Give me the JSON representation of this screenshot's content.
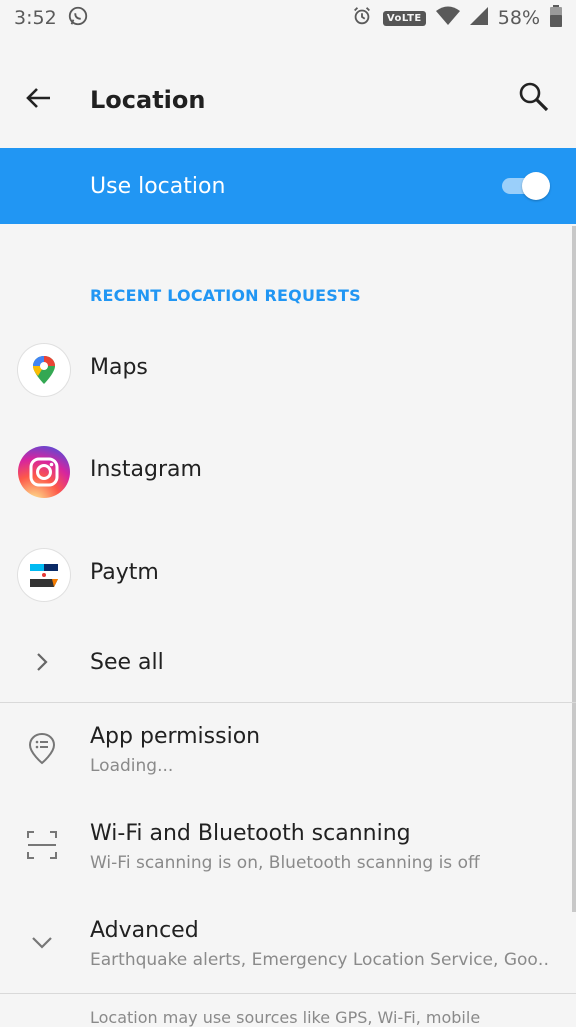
{
  "status_bar": {
    "time": "3:52",
    "volte": "VoLTE",
    "battery": "58%"
  },
  "toolbar": {
    "title": "Location"
  },
  "master_switch": {
    "label": "Use location",
    "enabled": true,
    "accent": "#2196f3"
  },
  "recent": {
    "header": "RECENT LOCATION REQUESTS",
    "apps": [
      {
        "label": "Maps",
        "icon": "maps-icon"
      },
      {
        "label": "Instagram",
        "icon": "instagram-icon"
      },
      {
        "label": "Paytm",
        "icon": "paytm-icon"
      }
    ],
    "see_all": "See all"
  },
  "prefs": [
    {
      "title": "App permission",
      "summary": "Loading...",
      "icon": "location-list-icon"
    },
    {
      "title": "Wi-Fi and Bluetooth scanning",
      "summary": "Wi-Fi scanning is on, Bluetooth scanning is off",
      "icon": "scan-icon"
    },
    {
      "title": "Advanced",
      "summary": "Earthquake alerts, Emergency Location Service, Goo‥",
      "icon": "chevron-down-icon"
    }
  ],
  "footer": "Location may use sources like GPS, Wi-Fi, mobile"
}
